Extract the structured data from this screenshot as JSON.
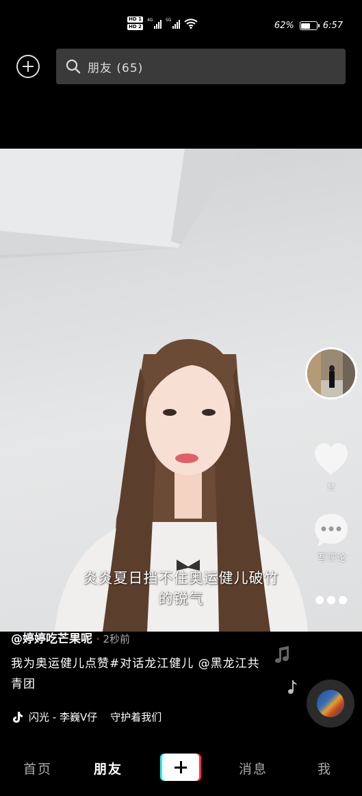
{
  "status_bar": {
    "battery_percent": "62%",
    "time": "6:57",
    "sim1": "HD 1",
    "sim2": "HD 2",
    "net1": "4G",
    "net2": "5G",
    "battery_level": 0.62
  },
  "top_bar": {
    "search_text": "朋友 (65)"
  },
  "video": {
    "subtitle_line1": "炎炎夏日挡不住奥运健儿破竹",
    "subtitle_line2": "的锐气"
  },
  "right_rail": {
    "like_label": "赞",
    "comment_label": "写评论"
  },
  "caption": {
    "author": "@婷婷吃芒果呢",
    "time": "· 2秒前",
    "description": "我为奥运健儿点赞#对话龙江健儿 @黑龙江共青团",
    "music": "闪光 - 李巍V仔    守护着我们"
  },
  "bottom_nav": {
    "items": [
      {
        "label": "首页",
        "active": false
      },
      {
        "label": "朋友",
        "active": true
      },
      {
        "label": "消息",
        "active": false
      },
      {
        "label": "我",
        "active": false
      }
    ]
  },
  "colors": {
    "background": "#000000",
    "search_bg": "#3a3a3a",
    "create_cyan": "#25f4ee",
    "create_red": "#fe2c55"
  }
}
